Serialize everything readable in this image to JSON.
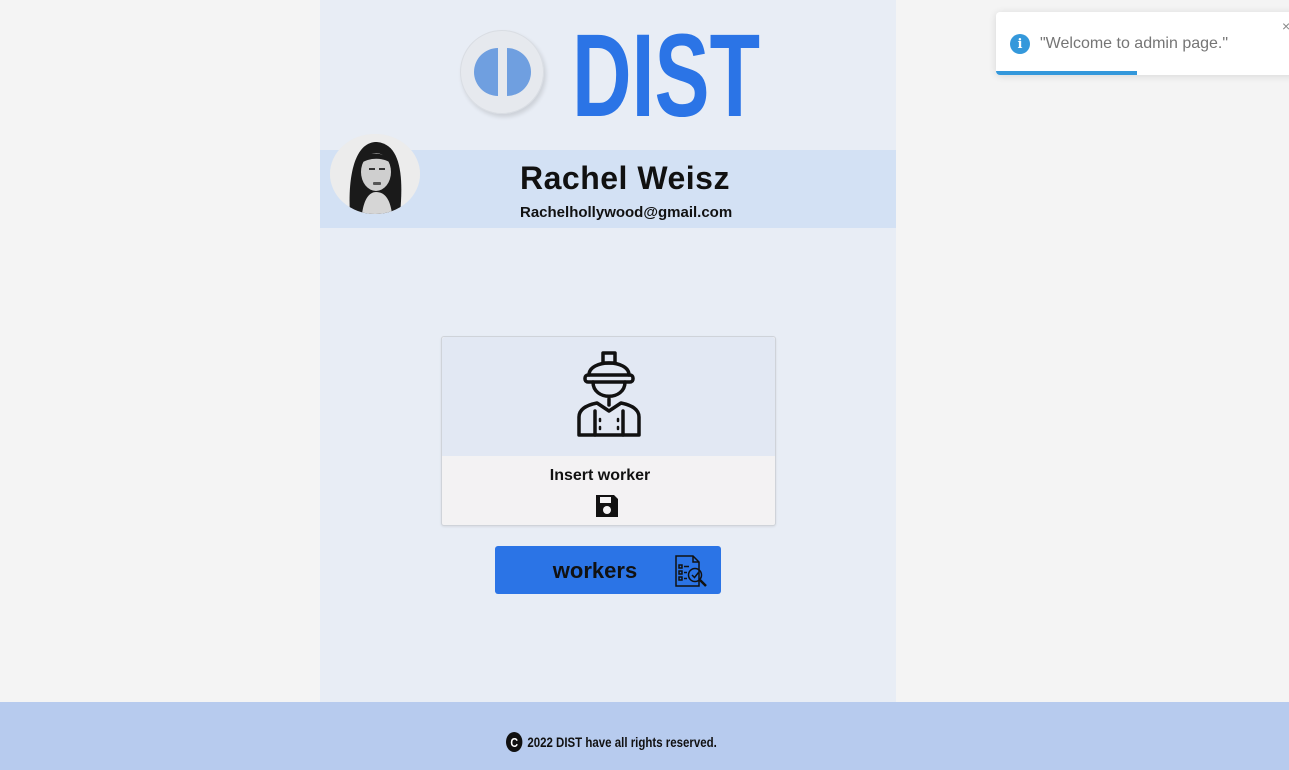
{
  "brand": {
    "logo_text": "DIST",
    "color": "#2b74e6"
  },
  "profile": {
    "name": "Rachel Weisz",
    "email": "Rachelhollywood@gmail.com"
  },
  "actions": {
    "insert_worker": {
      "label": "Insert worker",
      "icon": "worker-icon",
      "action_icon": "save-icon"
    },
    "workers": {
      "label": "workers",
      "icon": "document-search-icon"
    }
  },
  "footer": {
    "text": "2022 DIST have all rights reserved.",
    "icon": "copyright-icon",
    "icon_glyph": "C"
  },
  "toast": {
    "message": "\"Welcome to admin page.\"",
    "icon": "info-icon",
    "icon_glyph": "i",
    "close_glyph": "×",
    "progress": 0.47,
    "accent": "#3498db"
  }
}
